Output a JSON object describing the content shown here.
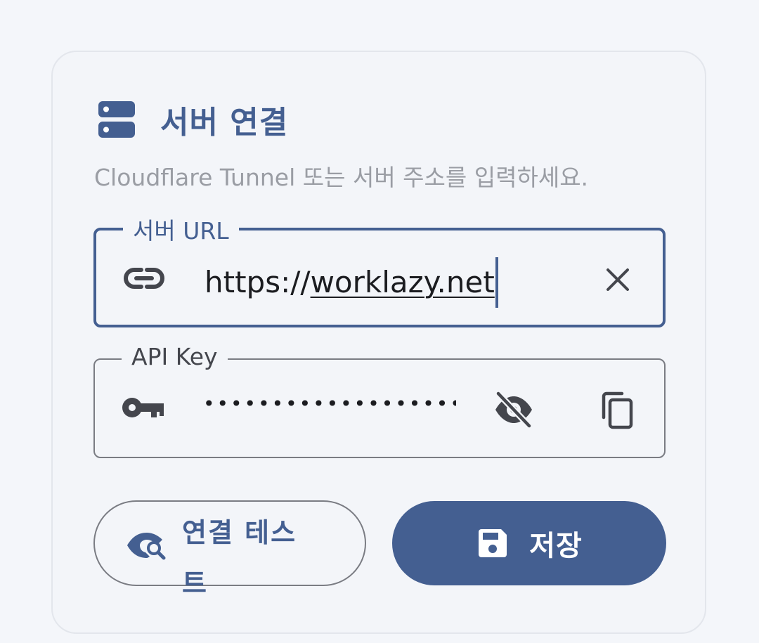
{
  "card": {
    "title": "서버 연결",
    "title_icon": "server-icon",
    "subtitle": "Cloudflare Tunnel 또는 서버 주소를 입력하세요."
  },
  "url_field": {
    "label": "서버 URL",
    "leading_icon": "link-icon",
    "value_prefix": "https://",
    "value_rest": "worklazy.net",
    "trailing_icon": "close-icon",
    "state": "focused"
  },
  "api_key_field": {
    "label": "API Key",
    "leading_icon": "key-icon",
    "masked_value": "••••••••••••••••••••••••••••••",
    "visibility_icon": "visibility-off-icon",
    "copy_icon": "copy-icon"
  },
  "buttons": {
    "test": {
      "label": "연결 테스트",
      "icon": "eye-search-icon"
    },
    "save": {
      "label": "저장",
      "icon": "save-icon"
    }
  },
  "colors": {
    "primary": "#445f91",
    "background": "#f3f5f9",
    "outline": "#7a7c83",
    "subtitle": "#9a9da4",
    "on_primary": "#ffffff"
  }
}
